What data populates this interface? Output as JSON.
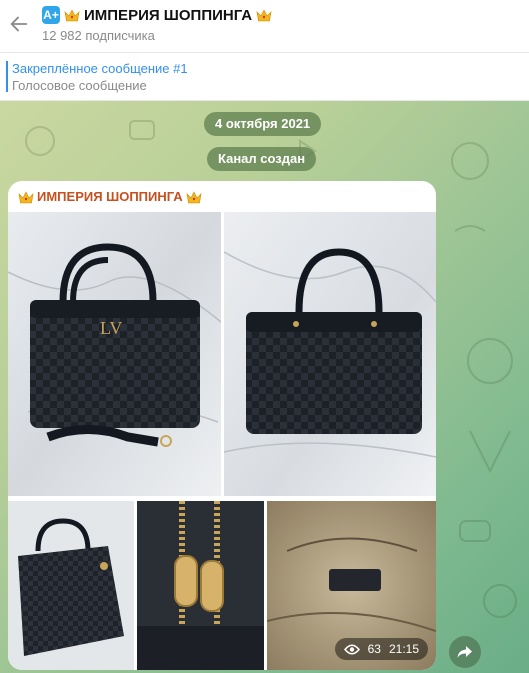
{
  "header": {
    "back_icon": "arrow-left-icon",
    "app_badge": "A+",
    "title": "ИМПЕРИЯ ШОППИНГА",
    "subscribers": "12 982 подписчика"
  },
  "pinned": {
    "title": "Закреплённое сообщение #1",
    "subtitle": "Голосовое сообщение"
  },
  "chat": {
    "date_pill": "4 октября 2021",
    "service_pill": "Канал создан"
  },
  "post": {
    "author": "ИМПЕРИЯ ШОППИНГА",
    "views": "63",
    "time": "21:15",
    "views_icon": "eye-icon",
    "share_icon": "share-arrow-icon"
  },
  "colors": {
    "accent": "#3390ec",
    "author_name": "#c8501e",
    "service_pill_bg": "#5c7c4c"
  }
}
